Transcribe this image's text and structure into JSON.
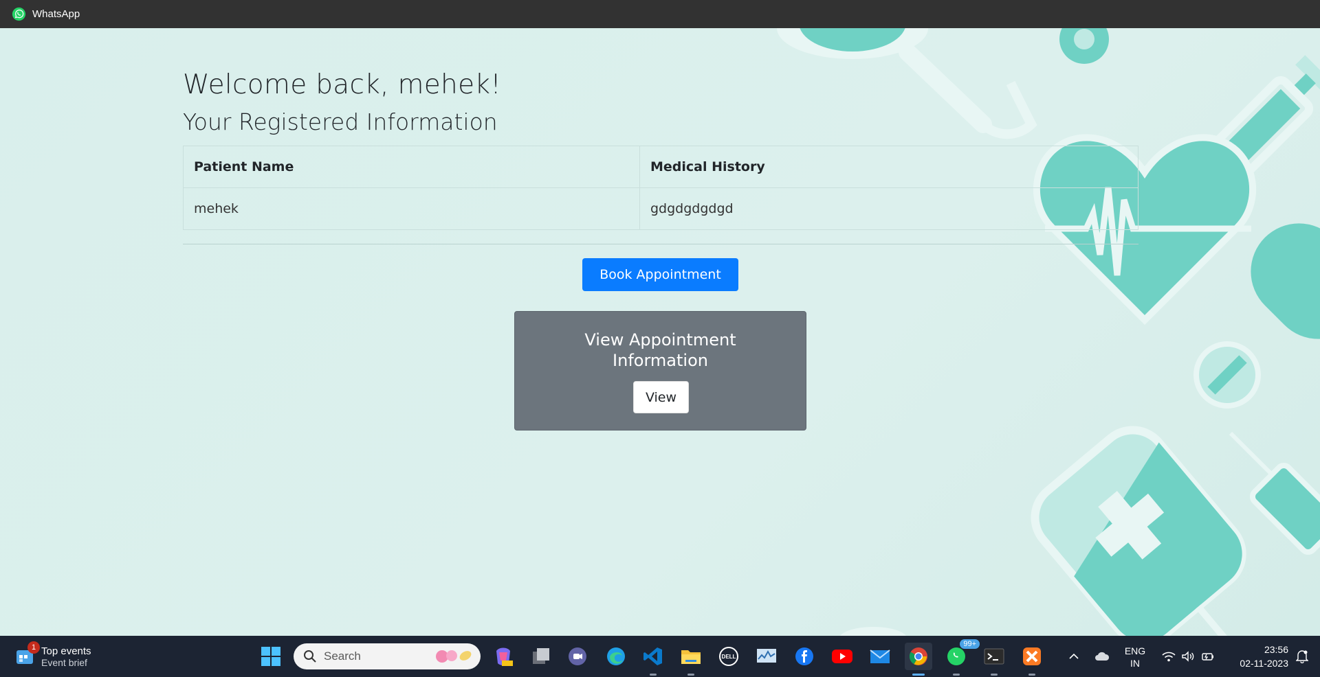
{
  "window": {
    "title": "WhatsApp"
  },
  "page": {
    "welcome": "Welcome back, mehek!",
    "subtitle": "Your Registered Information",
    "table": {
      "headers": [
        "Patient Name",
        "Medical History"
      ],
      "rows": [
        [
          "mehek",
          "gdgdgdgdgd"
        ]
      ]
    },
    "book_button": "Book Appointment",
    "card": {
      "title": "View Appointment Information",
      "button": "View"
    }
  },
  "taskbar": {
    "widget": {
      "title": "Top events",
      "subtitle": "Event brief",
      "badge": "1"
    },
    "search": {
      "placeholder": "Search"
    },
    "apps": [
      {
        "name": "start"
      },
      {
        "name": "copilot"
      },
      {
        "name": "task-view"
      },
      {
        "name": "teams"
      },
      {
        "name": "edge"
      },
      {
        "name": "vscode"
      },
      {
        "name": "file-explorer"
      },
      {
        "name": "dell"
      },
      {
        "name": "monitor"
      },
      {
        "name": "facebook"
      },
      {
        "name": "youtube"
      },
      {
        "name": "mail"
      },
      {
        "name": "chrome"
      },
      {
        "name": "whatsapp",
        "badge": "99+"
      },
      {
        "name": "terminal"
      },
      {
        "name": "xampp"
      }
    ],
    "tray": {
      "lang_1": "ENG",
      "lang_2": "IN",
      "time": "23:56",
      "date": "02-11-2023"
    }
  },
  "colors": {
    "primary": "#0a7cff",
    "card": "#6c757d",
    "background": "#d9efec",
    "accent": "#6fd1c4",
    "titlebar": "#323232",
    "taskbar": "#1c2433"
  }
}
